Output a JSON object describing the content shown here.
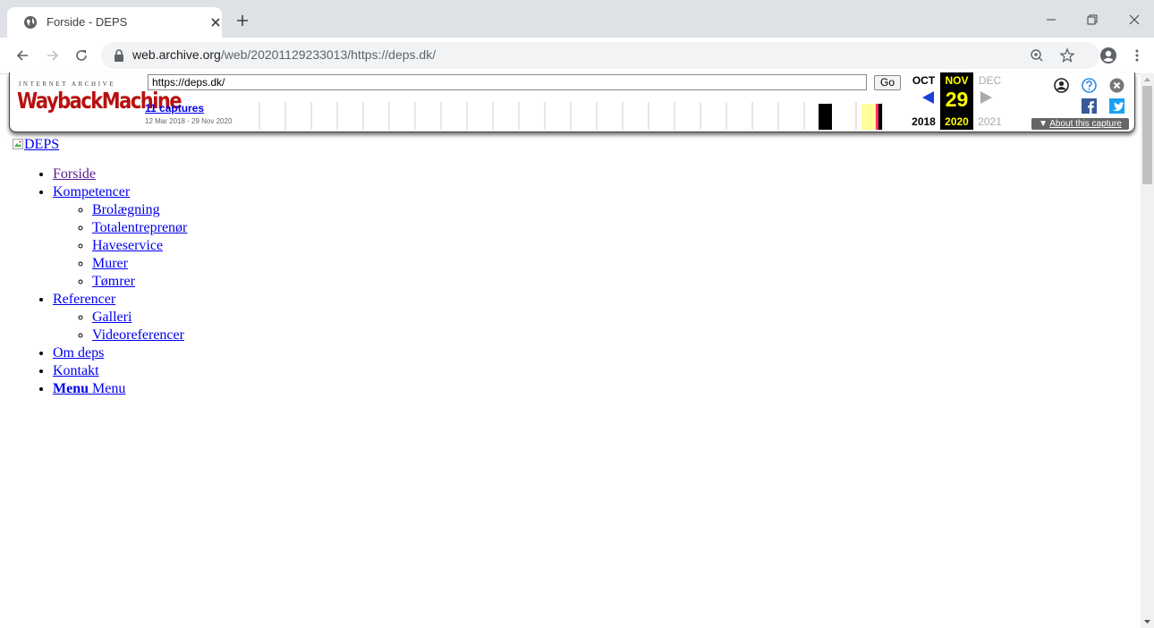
{
  "browser": {
    "tab_title": "Forside - DEPS",
    "url_host": "web.archive.org",
    "url_path": "/web/20201129233013/https://deps.dk/"
  },
  "wayback": {
    "ia_label": "INTERNET ARCHIVE",
    "logo_text": "WaybackMachine",
    "url_value": "https://deps.dk/",
    "go_label": "Go",
    "captures_label": "11 captures",
    "date_range": "12 Mar 2018 - 29 Nov 2020",
    "months": {
      "prev": "OCT",
      "current": "NOV",
      "next": "DEC"
    },
    "day": "29",
    "years": {
      "prev": "2018",
      "current": "2020",
      "next": "2021"
    },
    "about_label": "About this capture"
  },
  "page": {
    "logo_alt": "DEPS",
    "nav": [
      {
        "label": "Forside"
      },
      {
        "label": "Kompetencer",
        "children": [
          "Brolægning",
          "Totalentreprenør",
          "Haveservice",
          "Murer",
          "Tømrer"
        ]
      },
      {
        "label": "Referencer",
        "children": [
          "Galleri",
          "Videoreferencer"
        ]
      },
      {
        "label": "Om deps"
      },
      {
        "label": "Kontakt"
      }
    ],
    "menu_bold": "Menu",
    "menu_plain": "Menu"
  },
  "colors": {
    "wayback_logo": "#b8100f",
    "current_month_bg": "#000000",
    "current_highlight": "#ffff00",
    "link": "#0000ee",
    "visited_link": "#551a8b"
  }
}
